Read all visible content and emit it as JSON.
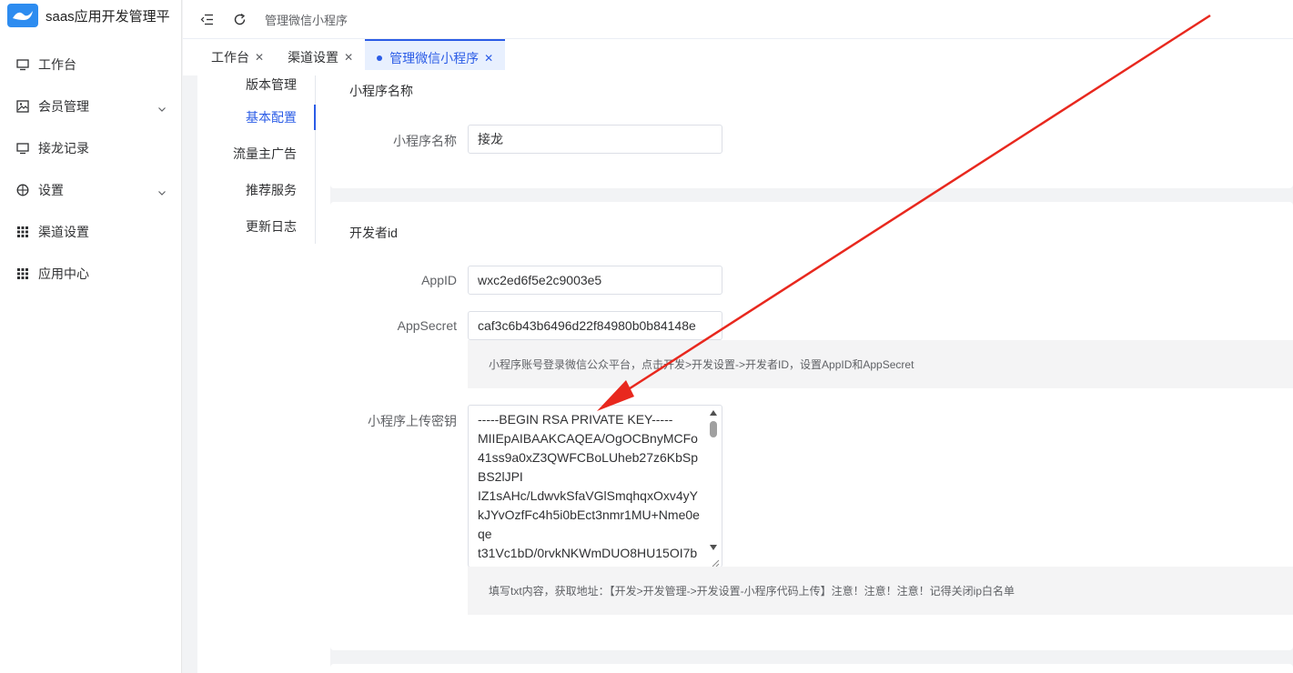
{
  "app": {
    "title": "saas应用开发管理平"
  },
  "sidebar": {
    "items": [
      {
        "label": "工作台",
        "icon": "monitor-icon",
        "expandable": false
      },
      {
        "label": "会员管理",
        "icon": "picture-icon",
        "expandable": true
      },
      {
        "label": "接龙记录",
        "icon": "monitor-icon",
        "expandable": false
      },
      {
        "label": "设置",
        "icon": "dashboard-icon",
        "expandable": true
      },
      {
        "label": "渠道设置",
        "icon": "grid-icon",
        "expandable": false
      },
      {
        "label": "应用中心",
        "icon": "grid-icon",
        "expandable": false
      }
    ]
  },
  "header": {
    "breadcrumb": "管理微信小程序"
  },
  "tabs": [
    {
      "label": "工作台",
      "active": false
    },
    {
      "label": "渠道设置",
      "active": false
    },
    {
      "label": "管理微信小程序",
      "active": true
    }
  ],
  "subnav": {
    "items": [
      {
        "label": "版本管理",
        "active": false
      },
      {
        "label": "基本配置",
        "active": true
      },
      {
        "label": "流量主广告",
        "active": false
      },
      {
        "label": "推荐服务",
        "active": false
      },
      {
        "label": "更新日志",
        "active": false
      }
    ]
  },
  "section_name": {
    "title": "小程序名称",
    "field_label": "小程序名称",
    "field_value": "接龙"
  },
  "section_dev": {
    "title": "开发者id",
    "appid_label": "AppID",
    "appid_value": "wxc2ed6f5e2c9003e5",
    "secret_label": "AppSecret",
    "secret_value": "caf3c6b43b6496d22f84980b0b84148e",
    "hint1": "小程序账号登录微信公众平台，点击开发>开发设置->开发者ID，设置AppID和AppSecret",
    "key_label": "小程序上传密钥",
    "key_value": "-----BEGIN RSA PRIVATE KEY-----\nMIIEpAIBAAKCAQEA/OgOCBnyMCFo41ss9a0xZ3QWFCBoLUheb27z6KbSpBS2lJPI\nIZ1sAHc/LdwvkSfaVGlSmqhqxOxv4yYkJYvOzfFc4h5i0bEct3nmr1MU+Nme0eqe\nt31Vc1bD/0rvkNKWmDUO8HU15OI7b",
    "hint2": "填写txt内容，获取地址：【开发>开发管理->开发设置-小程序代码上传】注意！注意！注意！记得关闭ip白名单"
  },
  "colors": {
    "accent": "#2b5ce6",
    "arrow": "#e8281e"
  }
}
